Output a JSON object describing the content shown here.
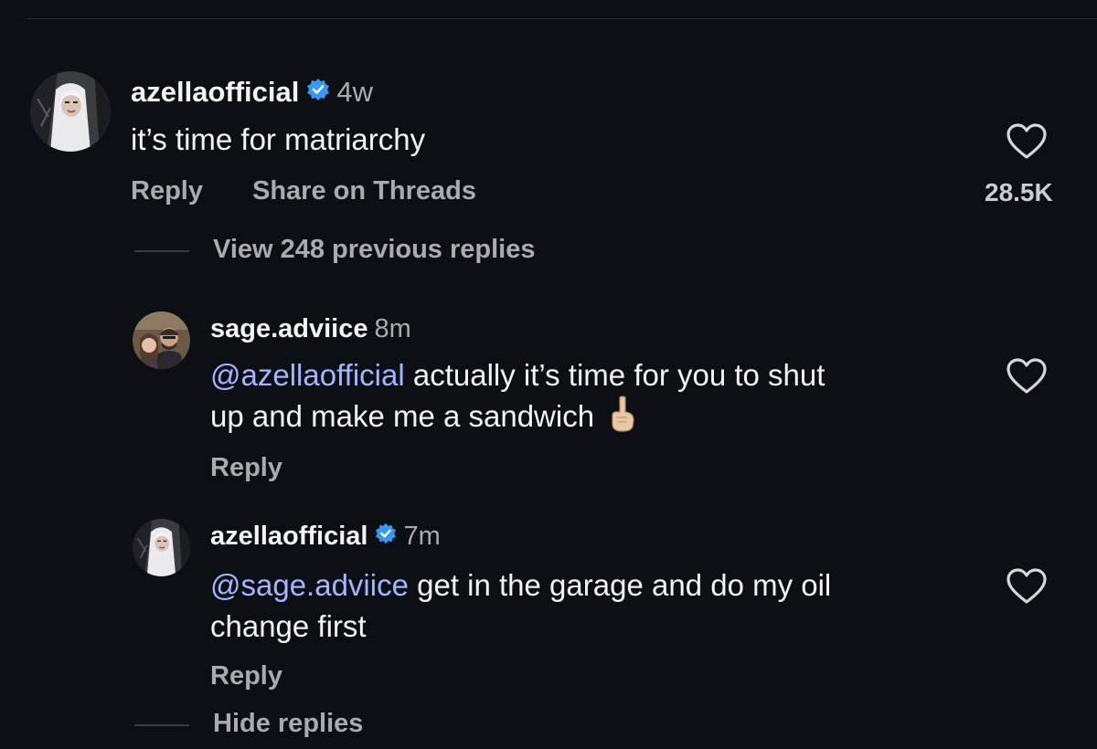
{
  "comments": [
    {
      "username": "azellaofficial",
      "verified": true,
      "time": "4w",
      "text": "it’s time for matriarchy",
      "reply_label": "Reply",
      "share_label": "Share on Threads",
      "like_count": "28.5K",
      "avatar": "woman-profile-avatar"
    }
  ],
  "thread": {
    "view_previous_label": "View 248 previous replies",
    "hide_replies_label": "Hide replies"
  },
  "replies": [
    {
      "username": "sage.adviice",
      "verified": false,
      "time": "8m",
      "mention": "@azellaofficial",
      "text_line1": " actually it’s time for you to shut",
      "text_line2": "up and make me a sandwich",
      "emoji": "middle-finger-emoji",
      "reply_label": "Reply",
      "avatar": "couple-photo-avatar"
    },
    {
      "username": "azellaofficial",
      "verified": true,
      "time": "7m",
      "mention": "@sage.adviice",
      "text_line1": " get in the garage and do my oil",
      "text_line2": "change first",
      "reply_label": "Reply",
      "avatar": "woman-profile-avatar"
    }
  ],
  "colors": {
    "background": "#0c0f14",
    "mention": "#a4b4ff",
    "verified_badge": "#3897f0",
    "secondary_text": "#a8abb2"
  }
}
